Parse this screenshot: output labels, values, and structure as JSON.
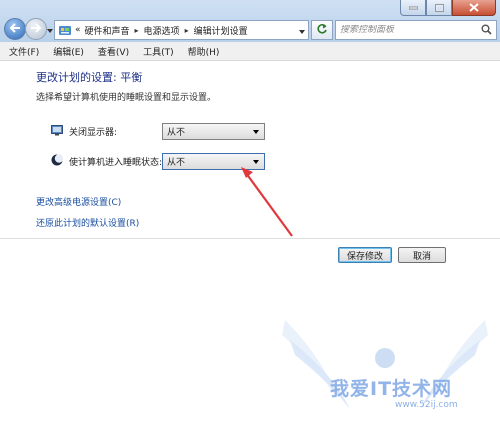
{
  "window": {
    "controls": [
      "minimize-icon",
      "maximize-icon",
      "close-icon"
    ]
  },
  "address": {
    "prefix": "«",
    "segments": [
      "硬件和声音",
      "电源选项",
      "编辑计划设置"
    ]
  },
  "search": {
    "placeholder": "搜索控制面板"
  },
  "menu": [
    "文件(F)",
    "编辑(E)",
    "查看(V)",
    "工具(T)",
    "帮助(H)"
  ],
  "main": {
    "title": "更改计划的设置: 平衡",
    "subtitle": "选择希望计算机使用的睡眠设置和显示设置。",
    "settings": [
      {
        "label": "关闭显示器:",
        "icon": "monitor-icon",
        "value": "从不"
      },
      {
        "label": "使计算机进入睡眠状态:",
        "icon": "moon-icon",
        "value": "从不"
      }
    ],
    "links": [
      "更改高级电源设置(C)",
      "还原此计划的默认设置(R)"
    ],
    "buttons": {
      "save": "保存修改",
      "cancel": "取消"
    }
  },
  "watermark": {
    "text": "我爱IT技术网",
    "url": "www.52ij.com"
  },
  "colors": {
    "title": "#1e3287",
    "link": "#1a4fa1",
    "arrow": "#e0393c",
    "watermark": "#7fa8e6"
  }
}
